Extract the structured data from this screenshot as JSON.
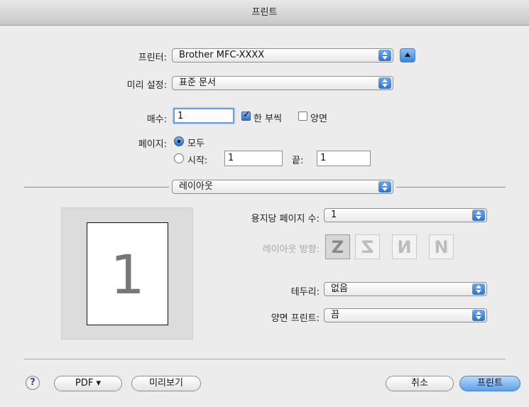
{
  "window": {
    "title": "프린트"
  },
  "printer": {
    "label": "프린터:",
    "value": "Brother MFC-XXXX"
  },
  "presets": {
    "label": "미리 설정:",
    "value": "표준 문서"
  },
  "copies": {
    "label": "매수:",
    "value": "1",
    "collated_label": "한 부씩",
    "collated": true,
    "duplex_label": "양면",
    "duplex": false
  },
  "pages": {
    "label": "페이지:",
    "all_label": "모두",
    "from_label": "시작:",
    "from_value": "1",
    "to_label": "끝:",
    "to_value": "1",
    "selected": "all"
  },
  "section": {
    "value": "레이아웃"
  },
  "layout": {
    "pages_per_sheet_label": "용지당 페이지 수:",
    "pages_per_sheet_value": "1",
    "direction_label": "레이아웃 방향:",
    "directions": [
      "Z",
      "S",
      "N-reverse",
      "N"
    ],
    "direction_glyphs": [
      "Z",
      "Z",
      "И",
      "N"
    ],
    "border_label": "테두리:",
    "border_value": "없음",
    "two_sided_label": "양면 프린트:",
    "two_sided_value": "끔"
  },
  "preview": {
    "page_number": "1"
  },
  "footer": {
    "help": "?",
    "pdf": "PDF ▾",
    "preview": "미리보기",
    "cancel": "취소",
    "print": "프린트"
  },
  "colors": {
    "accent": "#3e82d6",
    "background": "#ececec"
  }
}
